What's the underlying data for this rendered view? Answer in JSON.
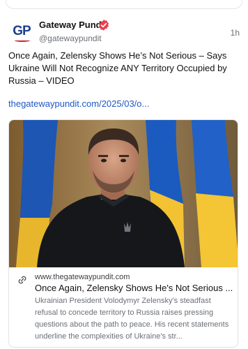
{
  "post": {
    "author": {
      "name": "Gateway Pundit",
      "handle": "@gatewaypundit",
      "avatar_text": "GP",
      "verified": true
    },
    "timestamp": "1h",
    "text": "Once Again, Zelensky Shows He’s Not Serious – Says Ukraine Will Not Recognize ANY Territory Occupied by Russia – VIDEO",
    "link": "thegatewaypundit.com/2025/03/o..."
  },
  "link_card": {
    "icon": "link-icon",
    "domain": "www.thegatewaypundit.com",
    "title": "Once Again, Zelensky Shows He's Not Serious ...",
    "description": "Ukrainian President Volodymyr Zelensky's steadfast refusal to concede territory to Russia raises pressing questions about the path to peace. His recent statements underline the complexities of Ukraine's str..."
  },
  "colors": {
    "link": "#1f57c3",
    "verified_badge": "#e8414f",
    "brand_blue": "#1d3f8f",
    "brand_red": "#c8202a",
    "flag_blue": "#1b5bc0",
    "flag_yellow": "#f2c232"
  }
}
